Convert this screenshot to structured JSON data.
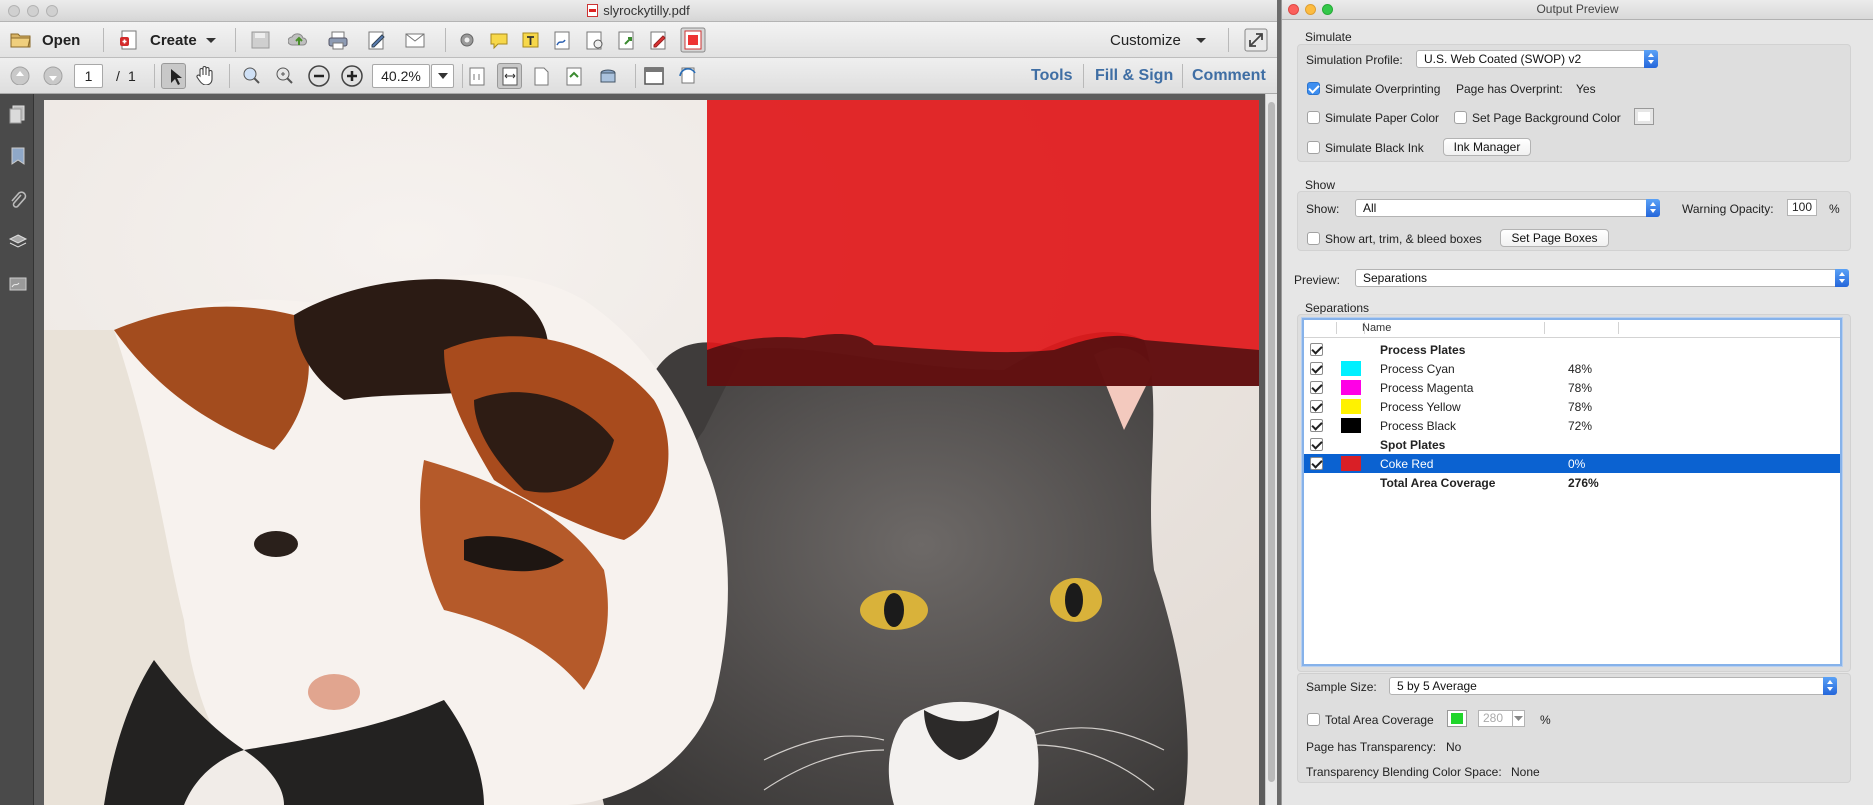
{
  "window": {
    "title": "slyrockytilly.pdf"
  },
  "toolbar": {
    "open_label": "Open",
    "create_label": "Create",
    "customize_label": "Customize"
  },
  "navbar": {
    "page_current": "1",
    "page_separator": "/",
    "page_total": "1",
    "zoom": "40.2%",
    "tabs": [
      "Tools",
      "Fill & Sign",
      "Comment"
    ]
  },
  "output_preview": {
    "title": "Output Preview",
    "simulate": {
      "group_label": "Simulate",
      "profile_label": "Simulation Profile:",
      "profile_value": "U.S. Web Coated (SWOP) v2",
      "overprinting_label": "Simulate Overprinting",
      "overprinting_checked": true,
      "has_overprint_label": "Page has Overprint:",
      "has_overprint_value": "Yes",
      "paper_color_label": "Simulate Paper Color",
      "page_bg_label": "Set Page Background Color",
      "black_ink_label": "Simulate Black Ink",
      "ink_manager_label": "Ink Manager"
    },
    "show": {
      "group_label": "Show",
      "show_label": "Show:",
      "show_value": "All",
      "warning_opacity_label": "Warning Opacity:",
      "warning_opacity_value": "100",
      "percent_sign": "%",
      "boxes_label": "Show art, trim, & bleed boxes",
      "set_page_boxes_label": "Set Page Boxes"
    },
    "preview": {
      "label": "Preview:",
      "value": "Separations"
    },
    "separations": {
      "group_label": "Separations",
      "column_name": "Name",
      "rows": [
        {
          "name": "Process Plates",
          "value": "",
          "color": ""
        },
        {
          "name": "Process Cyan",
          "value": "48%",
          "color": "#00f0ff"
        },
        {
          "name": "Process Magenta",
          "value": "78%",
          "color": "#ff00e6"
        },
        {
          "name": "Process Yellow",
          "value": "78%",
          "color": "#fff200"
        },
        {
          "name": "Process Black",
          "value": "72%",
          "color": "#000000"
        },
        {
          "name": "Spot Plates",
          "value": "",
          "color": ""
        },
        {
          "name": "Coke Red",
          "value": "0%",
          "color": "#d91f26"
        },
        {
          "name": "Total Area Coverage",
          "value": "276%",
          "color": ""
        }
      ],
      "selected_row": "Coke Red"
    },
    "sample_size": {
      "label": "Sample Size:",
      "value": "5 by 5 Average"
    },
    "total_area": {
      "label": "Total Area Coverage",
      "value": "280",
      "percent_sign": "%",
      "swatch_color": "#1fd62a"
    },
    "transparency": {
      "page_label": "Page has Transparency:",
      "page_value": "No",
      "blend_label": "Transparency Blending Color Space:",
      "blend_value": "None"
    }
  },
  "colors": {
    "accent": "#3f6ea4",
    "selection": "#0b62d1",
    "spot_overlay": "#e0191b"
  }
}
